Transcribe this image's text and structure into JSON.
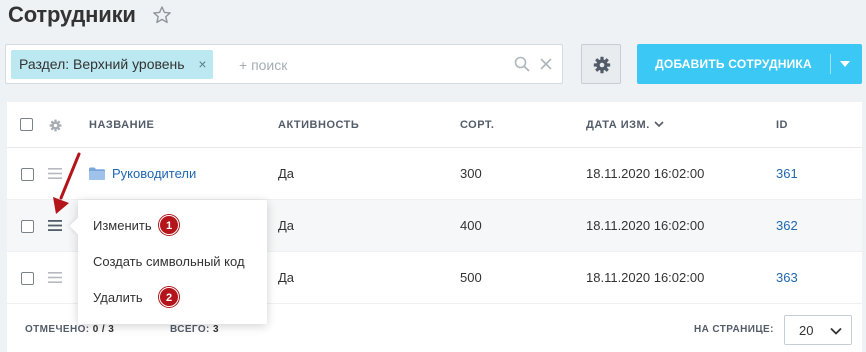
{
  "page": {
    "title": "Сотрудники"
  },
  "filter": {
    "chip_label": "Раздел: Верхний уровень",
    "chip_remove": "×",
    "search_placeholder": "+ поиск"
  },
  "toolbar": {
    "add_label": "ДОБАВИТЬ СОТРУДНИКА"
  },
  "table": {
    "headers": {
      "name": "НАЗВАНИЕ",
      "active": "АКТИВНОСТЬ",
      "sort": "СОРТ.",
      "date": "ДАТА ИЗМ.",
      "id": "ID"
    },
    "rows": [
      {
        "name": "Руководители",
        "active": "Да",
        "sort": "300",
        "date": "18.11.2020 16:02:00",
        "id": "361"
      },
      {
        "name": "",
        "active": "Да",
        "sort": "400",
        "date": "18.11.2020 16:02:00",
        "id": "362"
      },
      {
        "name": "",
        "active": "Да",
        "sort": "500",
        "date": "18.11.2020 16:02:00",
        "id": "363"
      }
    ]
  },
  "context_menu": {
    "items": [
      {
        "label": "Изменить",
        "badge": "1"
      },
      {
        "label": "Создать символьный код",
        "badge": ""
      },
      {
        "label": "Удалить",
        "badge": "2"
      }
    ]
  },
  "footer": {
    "selected_label": "ОТМЕЧЕНО:",
    "selected_value": "0 / 3",
    "total_label": "ВСЕГО:",
    "total_value": "3",
    "per_page_label": "НА СТРАНИЦЕ:",
    "per_page_value": "20"
  },
  "colors": {
    "accent": "#3bc8f5",
    "chip": "#bce8f1",
    "link": "#2067b0",
    "badge": "#b3151b"
  },
  "icons": {
    "favorite": "star-icon",
    "search": "search-icon",
    "clear": "close-icon",
    "settings": "gear-icon",
    "row_menu": "menu-lines-icon",
    "folder": "folder-icon"
  }
}
